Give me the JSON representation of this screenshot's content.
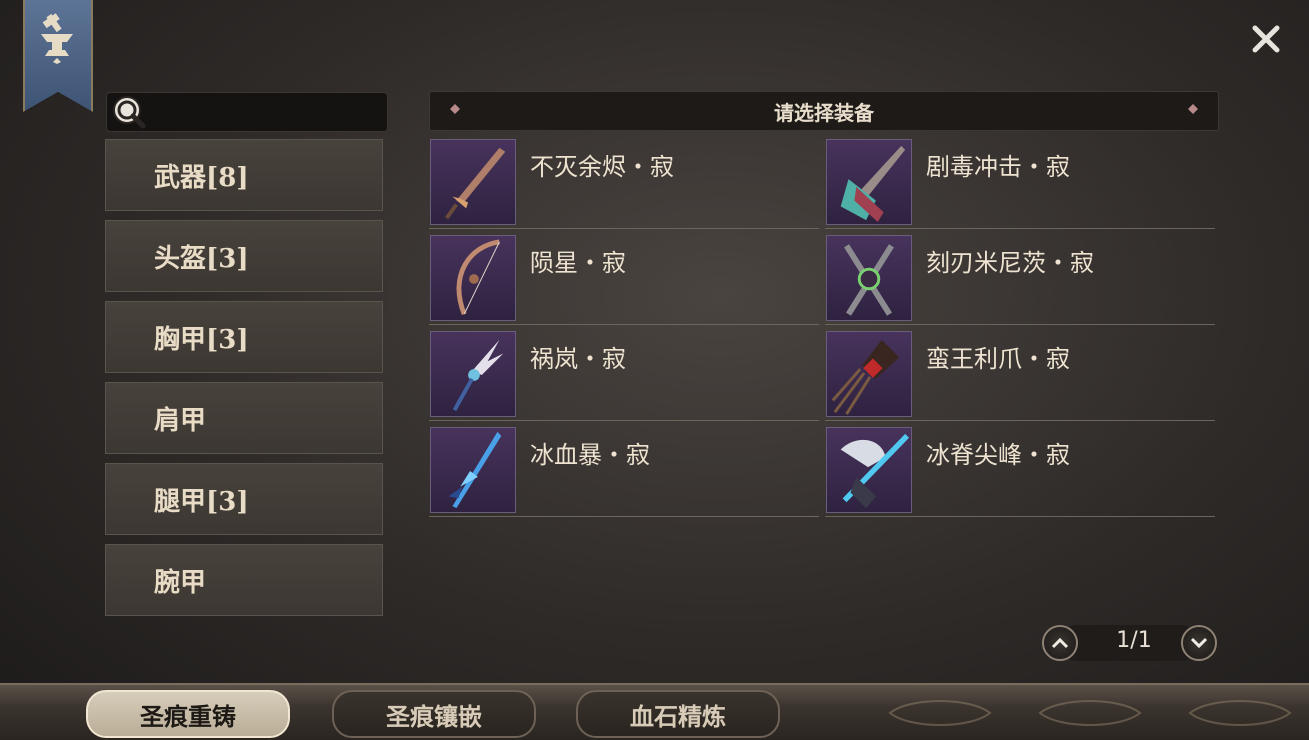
{
  "search": {
    "placeholder": ""
  },
  "categories": [
    {
      "label": "武器[8]",
      "active": true
    },
    {
      "label": "头盔[3]",
      "active": false
    },
    {
      "label": "胸甲[3]",
      "active": false
    },
    {
      "label": "肩甲",
      "active": false
    },
    {
      "label": "腿甲[3]",
      "active": false
    },
    {
      "label": "腕甲",
      "active": false
    }
  ],
  "list_header": "请选择装备",
  "items": [
    {
      "name": "不灭余烬・寂",
      "icon": "sword-icon"
    },
    {
      "name": "剧毒冲击・寂",
      "icon": "greatsword-icon"
    },
    {
      "name": "陨星・寂",
      "icon": "bow-icon"
    },
    {
      "name": "刻刃米尼茨・寂",
      "icon": "twin-blades-icon"
    },
    {
      "name": "祸岚・寂",
      "icon": "winged-staff-icon"
    },
    {
      "name": "蛮王利爪・寂",
      "icon": "claw-icon"
    },
    {
      "name": "冰血暴・寂",
      "icon": "ice-spear-icon"
    },
    {
      "name": "冰脊尖峰・寂",
      "icon": "ice-lance-icon"
    }
  ],
  "pagination": {
    "text": "1/1",
    "current": 1,
    "total": 1
  },
  "tabs": [
    {
      "label": "圣痕重铸",
      "active": true
    },
    {
      "label": "圣痕镶嵌",
      "active": false
    },
    {
      "label": "血石精炼",
      "active": false
    }
  ],
  "colors": {
    "accent": "#c89a5e",
    "thumb_bg": "#3a2a4c",
    "banner": "#4e6485"
  }
}
